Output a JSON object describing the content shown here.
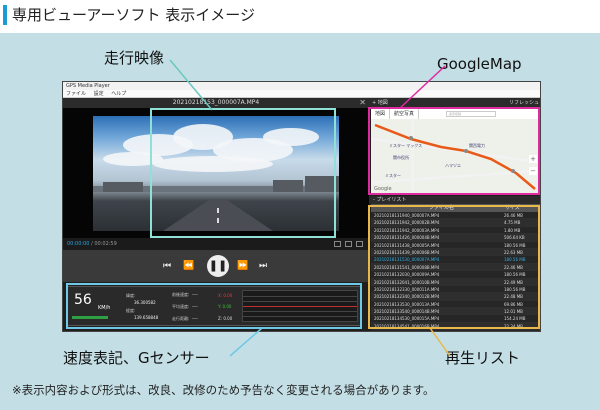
{
  "header": {
    "title": "専用ビューアーソフト 表示イメージ"
  },
  "callouts": {
    "video": "走行映像",
    "map": "GoogleMap",
    "speed": "速度表記、Gセンサー",
    "playlist": "再生リスト"
  },
  "app": {
    "window_title": "GPS Media Player",
    "menu": [
      "ファイル",
      "設定",
      "ヘルプ"
    ],
    "video": {
      "filename": "20210218153_000007A.MP4",
      "time_current": "00:00:00",
      "time_total": "/ 00:02:59"
    },
    "map_panel": {
      "header": "+ 地図",
      "refresh": "リフレッシュ",
      "tabs": [
        "地図",
        "航空写真"
      ],
      "search": "表示切替",
      "labels": [
        "ミスター マックス",
        "関市役所",
        "関西電力",
        "ミスター",
        "ハマヅエ"
      ],
      "google": "Google"
    },
    "playlist": {
      "header": "- プレイリスト",
      "col_name": "ファイル名",
      "col_size": "サイズ",
      "rows": [
        {
          "name": "20210218131940_000007A.MP4",
          "size": "26.46 MB"
        },
        {
          "name": "20210218131942_000002B.MP4",
          "size": "4.75 MB"
        },
        {
          "name": "20210218131942_000003A.MP4",
          "size": "1.80 MB"
        },
        {
          "name": "20210218131426_000004B.MP4",
          "size": "506.64 KB"
        },
        {
          "name": "20210218131438_000005A.MP4",
          "size": "180.56 MB"
        },
        {
          "name": "20210218131439_000006B.MP4",
          "size": "22.63 MB"
        },
        {
          "name": "20210218131530_000007A.MP4",
          "size": "180.56 MB"
        },
        {
          "name": "20210218131541_000008B.MP4",
          "size": "22.46 MB"
        },
        {
          "name": "20210218132030_000009A.MP4",
          "size": "180.56 MB"
        },
        {
          "name": "20210218132041_000010B.MP4",
          "size": "22.49 MB"
        },
        {
          "name": "20210218132330_000011A.MP4",
          "size": "180.56 MB"
        },
        {
          "name": "20210218132340_000012B.MP4",
          "size": "22.48 MB"
        },
        {
          "name": "20210218133530_000013A.MP4",
          "size": "69.86 MB"
        },
        {
          "name": "20210218133540_000014B.MP4",
          "size": "12.01 MB"
        },
        {
          "name": "20210218134530_000015A.MP4",
          "size": "154.24 MB"
        },
        {
          "name": "20210218134541_000016B.MP4",
          "size": "22.34 MB"
        }
      ],
      "highlight_index": 6
    },
    "dashboard": {
      "speed": "56",
      "speed_unit": "KM/h",
      "lat_label": "緯度:",
      "lat_value": "36.300582",
      "lon_label": "経度:",
      "lon_value": "139.658848",
      "r1_label": "前後速度:",
      "r1_value": "----",
      "r2_label": "平均速度:",
      "r2_value": "----",
      "r3_label": "走行距離:",
      "r3_value": "----",
      "gx": "X: 0.00",
      "gy": "Y: 0.00",
      "gz": "Z: 0.00"
    }
  },
  "note": "※表示内容および形式は、改良、改修のため予告なく変更される場合があります。",
  "colors": {
    "header_accent": "#1a9ad6",
    "panel_bg": "#c3dfe5",
    "video_box": "#8fe0d6",
    "map_box": "#e02aa0",
    "speed_box": "#6fc8e6",
    "playlist_box": "#e8b84a"
  }
}
